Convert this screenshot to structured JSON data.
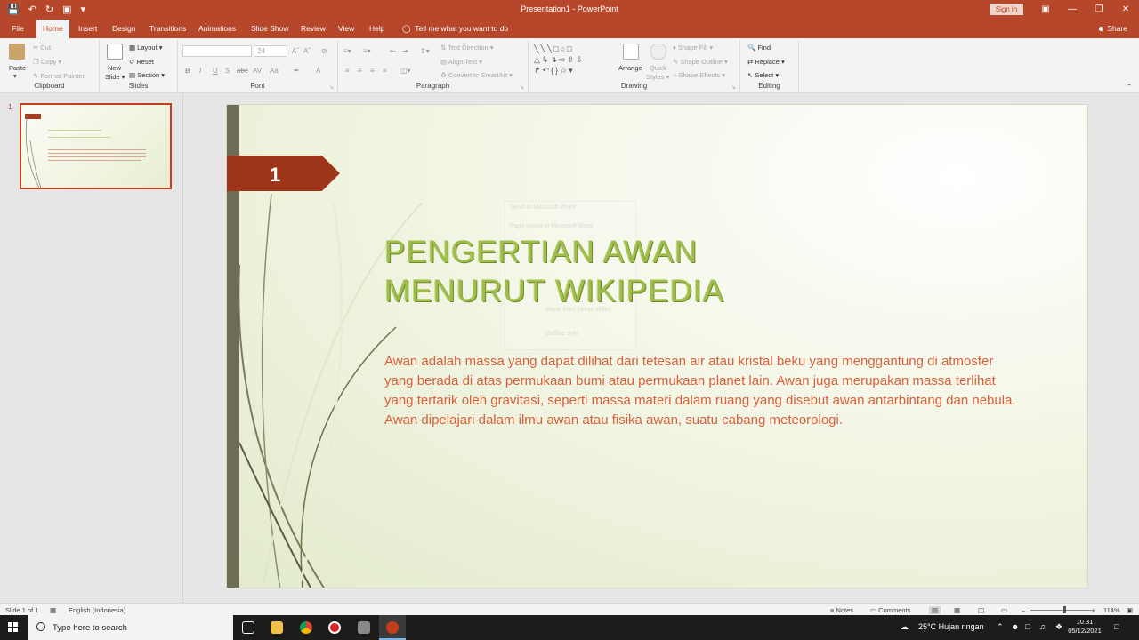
{
  "app": {
    "window_title": "Presentation1 - PowerPoint",
    "sign_in": "Sign in",
    "tell_me": "Tell me what you want to do",
    "share": "Share"
  },
  "tabs": [
    {
      "label": "File"
    },
    {
      "label": "Home",
      "active": true
    },
    {
      "label": "Insert"
    },
    {
      "label": "Design"
    },
    {
      "label": "Transitions"
    },
    {
      "label": "Animations"
    },
    {
      "label": "Slide Show"
    },
    {
      "label": "Review"
    },
    {
      "label": "View"
    },
    {
      "label": "Help"
    }
  ],
  "ribbon": {
    "clipboard": {
      "label": "Clipboard",
      "paste": "Paste",
      "cut": "Cut",
      "copy": "Copy",
      "format_painter": "Format Painter"
    },
    "slides": {
      "label": "Slides",
      "new_slide": "New",
      "new_slide_2": "Slide",
      "layout": "Layout",
      "reset": "Reset",
      "section": "Section"
    },
    "font": {
      "label": "Font",
      "size": "24",
      "bold": "B",
      "italic": "I",
      "underline": "U",
      "strike": "S",
      "shadow": "abc",
      "spacing": "AV",
      "case": "Aa",
      "color": "A"
    },
    "paragraph": {
      "label": "Paragraph",
      "text_direction": "Text Direction",
      "align_text": "Align Text",
      "smartart": "Convert to SmartArt"
    },
    "drawing": {
      "label": "Drawing",
      "arrange": "Arrange",
      "quick_styles": "Quick",
      "quick_styles_2": "Styles",
      "shape_fill": "Shape Fill",
      "shape_outline": "Shape Outline",
      "shape_effects": "Shape Effects"
    },
    "editing": {
      "label": "Editing",
      "find": "Find",
      "replace": "Replace",
      "select": "Select"
    }
  },
  "thumbnail": {
    "number": "1"
  },
  "slide": {
    "number": "1",
    "title_line1": "PENGERTIAN AWAN",
    "title_line2": "MENURUT WIKIPEDIA",
    "body": "Awan adalah massa yang dapat dilihat dari tetesan air atau kristal beku yang menggantung di atmosfer yang berada di atas permukaan bumi atau permukaan planet lain. Awan juga merupakan massa terlihat yang tertarik oleh gravitasi, seperti massa materi dalam ruang yang disebut awan antarbintang dan nebula. Awan dipelajari dalam ilmu awan atau fisika awan, suatu cabang meteorologi.",
    "ghost_dialog": {
      "title": "Send to Microsoft Word",
      "subtitle": "Page layout in Microsoft Word",
      "option1": "Blank lines below slides",
      "option2": "Outline only"
    }
  },
  "statusbar": {
    "slide_of": "Slide 1 of 1",
    "language": "English (Indonesia)",
    "notes": "Notes",
    "comments": "Comments",
    "zoom": "114%",
    "zoom_level": 0.56
  },
  "taskbar": {
    "search_placeholder": "Type here to search",
    "weather": "25°C  Hujan ringan",
    "time": "10.31",
    "date": "05/12/2021"
  },
  "colors": {
    "accent": "#b7472a",
    "title_green": "#9ebd49",
    "body_text": "#d9603a",
    "flag": "#9e3418"
  }
}
